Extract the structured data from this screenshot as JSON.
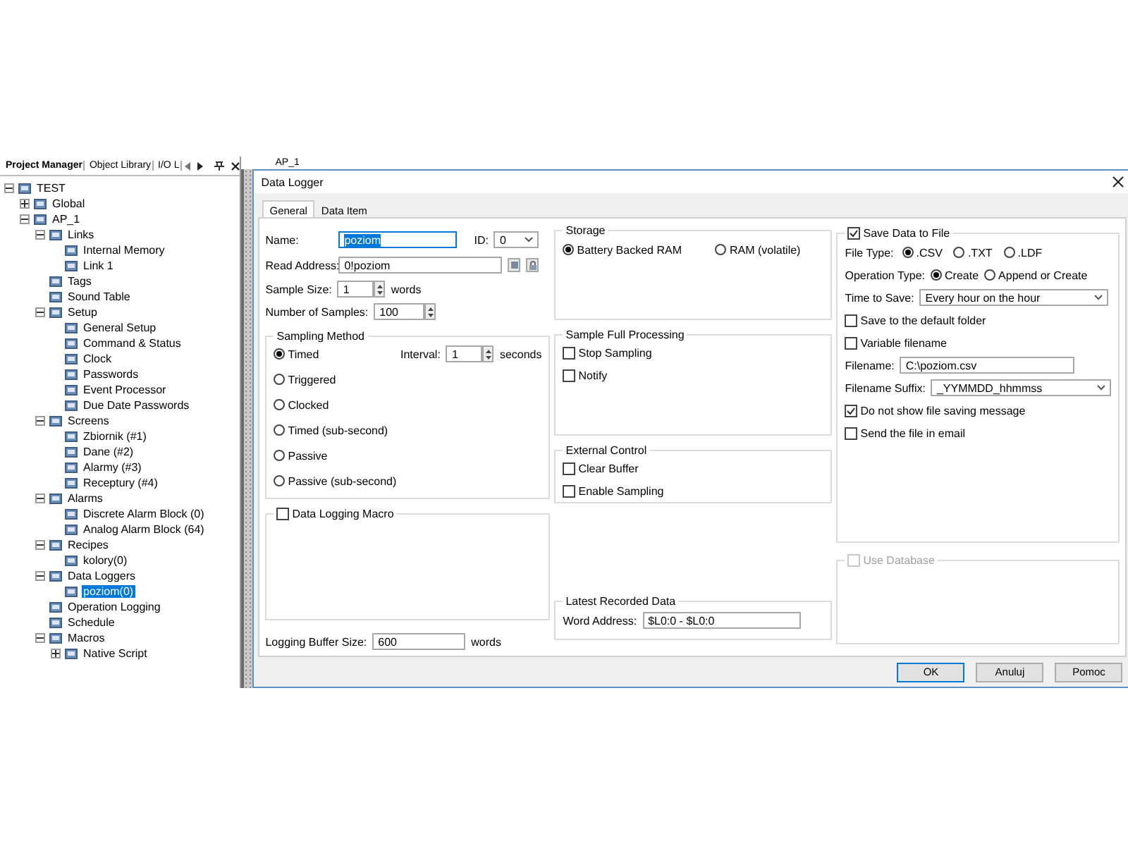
{
  "project_panel": {
    "tabs": [
      {
        "label": "Project Manager",
        "selected": true
      },
      {
        "label": "Object Library",
        "selected": false
      },
      {
        "label": "I/O L",
        "selected": false
      }
    ],
    "tree": [
      {
        "label": "TEST",
        "expanded": true,
        "selected": false,
        "children": [
          {
            "label": "Global",
            "expanded": false,
            "selected": false
          },
          {
            "label": "AP_1",
            "expanded": true,
            "selected": false,
            "children": [
              {
                "label": "Links",
                "expanded": true,
                "selected": false,
                "children": [
                  {
                    "label": "Internal Memory",
                    "selected": false
                  },
                  {
                    "label": "Link 1",
                    "selected": false
                  }
                ]
              },
              {
                "label": "Tags",
                "selected": false
              },
              {
                "label": "Sound Table",
                "selected": false
              },
              {
                "label": "Setup",
                "expanded": true,
                "selected": false,
                "children": [
                  {
                    "label": "General Setup",
                    "selected": false
                  },
                  {
                    "label": "Command & Status",
                    "selected": false
                  },
                  {
                    "label": "Clock",
                    "selected": false
                  },
                  {
                    "label": "Passwords",
                    "selected": false
                  },
                  {
                    "label": "Event Processor",
                    "selected": false
                  },
                  {
                    "label": "Due Date Passwords",
                    "selected": false
                  }
                ]
              },
              {
                "label": "Screens",
                "expanded": true,
                "selected": false,
                "children": [
                  {
                    "label": "Zbiornik (#1)",
                    "selected": false
                  },
                  {
                    "label": "Dane (#2)",
                    "selected": false
                  },
                  {
                    "label": "Alarmy (#3)",
                    "selected": false
                  },
                  {
                    "label": "Receptury (#4)",
                    "selected": false
                  }
                ]
              },
              {
                "label": "Alarms",
                "expanded": true,
                "selected": false,
                "children": [
                  {
                    "label": "Discrete Alarm Block (0)",
                    "selected": false
                  },
                  {
                    "label": "Analog Alarm Block (64)",
                    "selected": false
                  }
                ]
              },
              {
                "label": "Recipes",
                "expanded": true,
                "selected": false,
                "children": [
                  {
                    "label": "kolory(0)",
                    "selected": false
                  }
                ]
              },
              {
                "label": "Data Loggers",
                "expanded": true,
                "selected": false,
                "children": [
                  {
                    "label": "poziom(0)",
                    "selected": true
                  }
                ]
              },
              {
                "label": "Operation Logging",
                "selected": false
              },
              {
                "label": "Schedule",
                "selected": false
              },
              {
                "label": "Macros",
                "expanded": true,
                "selected": false,
                "children": [
                  {
                    "label": "Native Script",
                    "expanded": false,
                    "selected": false
                  }
                ]
              }
            ]
          }
        ]
      }
    ]
  },
  "editor_tab": {
    "label": "AP_1"
  },
  "dialog": {
    "title": "Data Logger",
    "tabs": [
      {
        "label": "General",
        "selected": true
      },
      {
        "label": "Data Item",
        "selected": false
      }
    ],
    "name": {
      "label": "Name:",
      "value": "poziom"
    },
    "id": {
      "label": "ID:",
      "value": "0"
    },
    "read_address": {
      "label": "Read Address:",
      "value": "0!poziom"
    },
    "sample_size": {
      "label": "Sample Size:",
      "value": "1",
      "unit": "words"
    },
    "number_of_samples": {
      "label": "Number of Samples:",
      "value": "100"
    },
    "sampling_method": {
      "title": "Sampling Method",
      "options": [
        {
          "label": "Timed",
          "selected": true
        },
        {
          "label": "Triggered",
          "selected": false
        },
        {
          "label": "Clocked",
          "selected": false
        },
        {
          "label": "Timed (sub-second)",
          "selected": false
        },
        {
          "label": "Passive",
          "selected": false
        },
        {
          "label": "Passive (sub-second)",
          "selected": false
        }
      ],
      "interval": {
        "label": "Interval:",
        "value": "1",
        "unit": "seconds"
      }
    },
    "macro": {
      "label": "Data Logging Macro",
      "checked": false
    },
    "buffer": {
      "label": "Logging Buffer Size:",
      "value": "600",
      "unit": "words"
    },
    "storage": {
      "title": "Storage",
      "options": [
        {
          "label": "Battery Backed RAM",
          "selected": true
        },
        {
          "label": "RAM (volatile)",
          "selected": false
        }
      ]
    },
    "sample_full": {
      "title": "Sample Full Processing",
      "options": [
        {
          "label": "Stop Sampling",
          "checked": false
        },
        {
          "label": "Notify",
          "checked": false
        }
      ]
    },
    "external_control": {
      "title": "External Control",
      "options": [
        {
          "label": "Clear Buffer",
          "checked": false
        },
        {
          "label": "Enable Sampling",
          "checked": false
        }
      ]
    },
    "latest": {
      "title": "Latest Recorded Data",
      "label": "Word Address:",
      "value": "$L0:0 - $L0:0"
    },
    "save_to_file": {
      "label": "Save Data to File",
      "checked": true,
      "file_type": {
        "label": "File Type:",
        "options": [
          {
            "label": ".CSV",
            "selected": true
          },
          {
            "label": ".TXT",
            "selected": false
          },
          {
            "label": ".LDF",
            "selected": false
          }
        ]
      },
      "operation_type": {
        "label": "Operation Type:",
        "options": [
          {
            "label": "Create",
            "selected": true
          },
          {
            "label": "Append or Create",
            "selected": false
          }
        ]
      },
      "time_to_save": {
        "label": "Time to Save:",
        "value": "Every hour on the hour"
      },
      "save_default": {
        "label": "Save to the default folder",
        "checked": false
      },
      "variable_filename": {
        "label": "Variable filename",
        "checked": false
      },
      "filename": {
        "label": "Filename:",
        "value": "C:\\poziom.csv"
      },
      "filename_suffix": {
        "label": "Filename Suffix:",
        "value": "_YYMMDD_hhmmss"
      },
      "no_message": {
        "label": "Do not show file saving message",
        "checked": true
      },
      "send_email": {
        "label": "Send the file in email",
        "checked": false
      }
    },
    "use_database": {
      "label": "Use Database",
      "checked": false,
      "disabled": true
    },
    "buttons": [
      {
        "label": "OK",
        "default": true
      },
      {
        "label": "Anuluj",
        "default": false
      },
      {
        "label": "Pomoc",
        "default": false
      }
    ]
  }
}
